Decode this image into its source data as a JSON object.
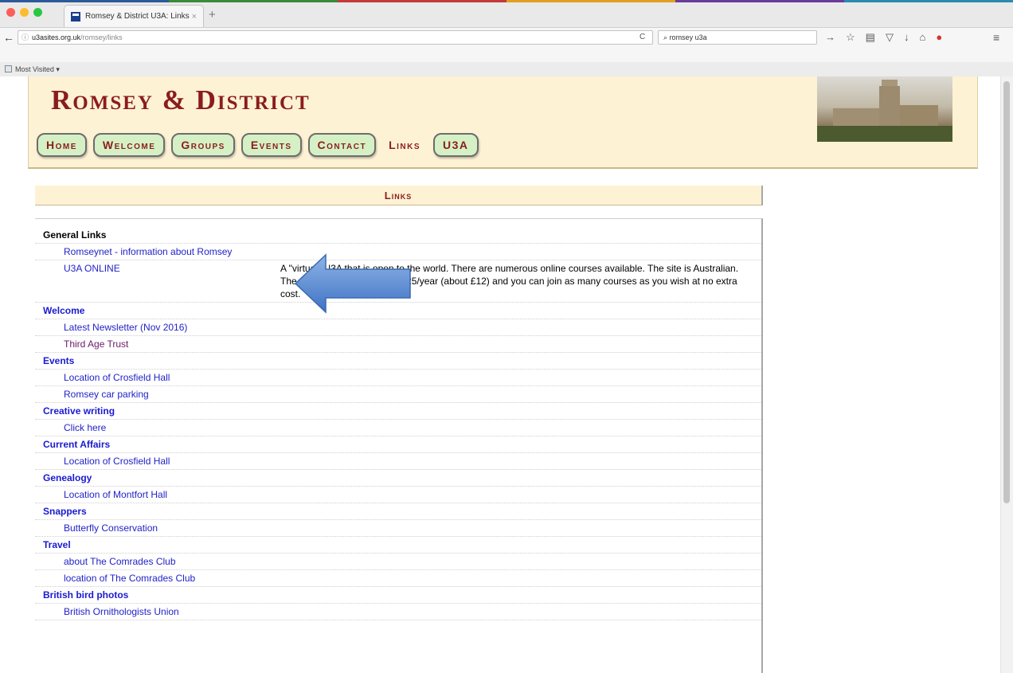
{
  "browser": {
    "tab_title": "Romsey & District U3A: Links",
    "tab_close": "×",
    "new_tab": "+",
    "url_host": "u3asites.org.uk",
    "url_path": "/romsey/links",
    "search_text": "romsey u3a",
    "bookmarks_label": "Most Visited ▾",
    "strip_colors": [
      "#2b5a9a",
      "#3a8a3a",
      "#c23a3a",
      "#e0a020",
      "#6a3a9a",
      "#2a8ab0"
    ]
  },
  "site": {
    "title": "Romsey & District",
    "accent": "#8b1c1c",
    "header_bg": "#fdf2d4",
    "nav": [
      {
        "label": "Home",
        "active": false
      },
      {
        "label": "Welcome",
        "active": false
      },
      {
        "label": "Groups",
        "active": false
      },
      {
        "label": "Events",
        "active": false
      },
      {
        "label": "Contact",
        "active": false
      },
      {
        "label": "Links",
        "active": true
      },
      {
        "label": "U3A",
        "active": false
      }
    ],
    "section_title": "Links"
  },
  "links": {
    "general_links": "General Links",
    "romseynet": "Romseynet - information about Romsey",
    "u3a_online": "U3A ONLINE",
    "u3a_online_desc": "A \"virtual\" U3A that is open to the world. There are numerous online courses available. The site is Australian. The cost of membership is A$25/year (about £12) and you can join as many courses as you wish at no extra cost.",
    "welcome": "Welcome",
    "newsletter": "Latest Newsletter (Nov 2016)",
    "third_age": "Third Age Trust",
    "events": "Events",
    "crosfield_1": "Location of Crosfield Hall",
    "car_parking": "Romsey car parking",
    "creative_writing": "Creative writing",
    "click_here": "Click here",
    "current_affairs": "Current Affairs",
    "crosfield_2": "Location of Crosfield Hall",
    "genealogy": "Genealogy",
    "montfort": "Location of Montfort Hall",
    "snappers": "Snappers",
    "butterfly": "Butterfly Conservation",
    "travel": "Travel",
    "comrades_about": "about The Comrades Club",
    "comrades_location": "location of The Comrades Club",
    "bird_photos": "British bird photos",
    "bou": "British Ornithologists Union"
  }
}
